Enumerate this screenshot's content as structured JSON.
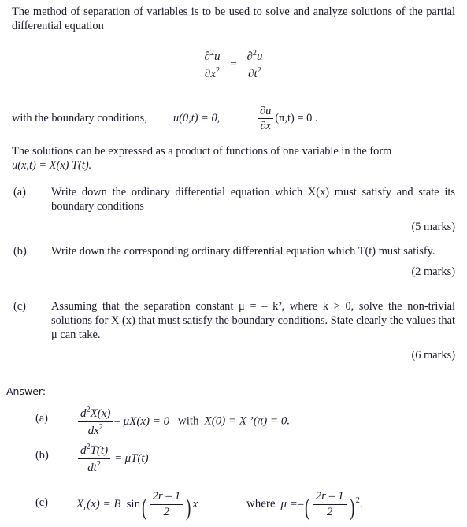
{
  "document": {
    "intro_paragraph": "The method of separation of variables is to be used to solve and analyze solutions of the partial differential equation",
    "product_form_paragraph_line1": "The solutions can be expressed as a product of functions of one variable in the form",
    "answer_heading": "Answer:"
  },
  "pde": {
    "lhs_numerator": "∂",
    "lhs_num_sup": "2",
    "lhs_num_var": "u",
    "lhs_den": "∂x",
    "lhs_den_sup": "2",
    "equals": "=",
    "rhs_numerator": "∂",
    "rhs_num_sup": "2",
    "rhs_num_var": "u",
    "rhs_den": "∂t",
    "rhs_den_sup": "2"
  },
  "boundary_conditions": {
    "label": "with the boundary conditions,",
    "condition1": "u(0,t) = 0,",
    "condition2_num": "∂u",
    "condition2_den": "∂x",
    "condition2_tail": "(π,t) = 0 ."
  },
  "product_form": {
    "equation": "u(x,t)  =  X(x) T(t)."
  },
  "questions": [
    {
      "marker": "(a)",
      "text": "Write down the ordinary differential equation which X(x) must satisfy and state its boundary conditions",
      "marks": "(5 marks)"
    },
    {
      "marker": "(b)",
      "text": "Write down the corresponding ordinary differential equation which T(t) must satisfy.",
      "marks": "(2 marks)"
    },
    {
      "marker": "(c)",
      "text": "Assuming that the separation constant μ = – k², where k > 0, solve the non-trivial solutions for X (x) that must satisfy the boundary conditions. State clearly the values that μ can take.",
      "marks": "(6 marks)"
    }
  ],
  "answers": {
    "a": {
      "marker": "(a)",
      "num": "d",
      "num_sup": "2",
      "num_fn": "X(x)",
      "den": "dx",
      "den_sup": "2",
      "tail": "– μX(x) = 0",
      "with_word": "with",
      "bc": "X(0) = X ’(π) = 0."
    },
    "b": {
      "marker": "(b)",
      "num": "d",
      "num_sup": "2",
      "num_fn": "T(t)",
      "den": "dt",
      "den_sup": "2",
      "equals": "=",
      "rhs": "μT(t)"
    },
    "c": {
      "marker": "(c)",
      "lhs_fn": "X",
      "lhs_sub": "r",
      "lhs_arg": "(x) = B",
      "sin": "sin",
      "frac_num": "2r – 1",
      "frac_den": "2",
      "after_paren": "x",
      "where_word": "where",
      "mu": "μ =",
      "minus": "–",
      "mu_frac_num": "2r – 1",
      "mu_frac_den": "2",
      "mu_sup": "2",
      "period": "."
    }
  },
  "colors": {
    "text": "#1b1b30",
    "background": "#ffffff"
  }
}
